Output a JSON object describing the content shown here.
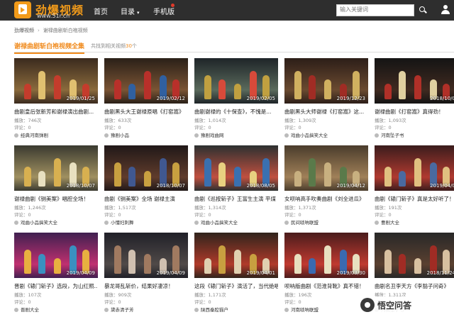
{
  "header": {
    "logo_text": "劲爆视频",
    "logo_domain": "www.51r.cn",
    "nav": [
      {
        "label": "首页"
      },
      {
        "label": "目录",
        "caret": "▾"
      },
      {
        "label": "手机版"
      }
    ],
    "search": {
      "placeholder": "输入关键词"
    },
    "brand_color": "#f29b1a"
  },
  "breadcrumb": {
    "items": [
      "劲爆视频",
      "谢禄曲剧斩白袍视频"
    ]
  },
  "section": {
    "title": "谢禄曲剧斩白袍视频全集",
    "count_prefix": "共找到相关视频",
    "count": "30",
    "count_suffix": "个",
    "accent_color": "#f08a1c"
  },
  "labels": {
    "play": "播放：",
    "comment": "评论："
  },
  "videos": [
    {
      "date": "2019/01/25",
      "title": "曲剧皇后张新芳和谢禄演出曲剧...",
      "plays": "746次",
      "comments": "0",
      "author": "经典河南弹剧"
    },
    {
      "date": "2019/02/12",
      "title": "曲剧黑头大王谢禄原唱《打窑嵩》",
      "plays": "633次",
      "comments": "0",
      "author": "豫剧小品"
    },
    {
      "date": "2019/02/05",
      "title": "曲剧谢禄的《十保查》，不愧是...",
      "plays": "1,014次",
      "comments": "0",
      "author": "豫剧戏曲网"
    },
    {
      "date": "2019/12/23",
      "title": "曲剧黑头大师谢禄《打窑嵩》这...",
      "plays": "1,309次",
      "comments": "0",
      "author": "戏曲小品搞笑大全"
    },
    {
      "date": "2018/10/0",
      "title": "谢禄曲剧《打窑嵩》真得劲！",
      "plays": "1,093次",
      "comments": "0",
      "author": "河南坠子书"
    },
    {
      "date": "2018/10/07",
      "title": "谢禄曲剧《铡美案》唱腔全场！",
      "plays": "1,246次",
      "comments": "0",
      "author": "戏曲小品搞笑大全"
    },
    {
      "date": "2018/10/07",
      "title": "曲剧《铡美案》全场 谢禄主演",
      "plays": "1,517次",
      "comments": "0",
      "author": "小懂妇刺舞"
    },
    {
      "date": "2018/08/05",
      "title": "曲剧《巡按斩子》王富生主演 平煤",
      "plays": "1,314次",
      "comments": "0",
      "author": "戏曲小品搞笑大全"
    },
    {
      "date": "2019/04/12",
      "title": "女呗呐高手吹奏曲剧《刘全进瓜》",
      "plays": "1,371次",
      "comments": "0",
      "author": "民间唢呐联盟"
    },
    {
      "date": "2019/04/0",
      "title": "曲剧《辕门斩子》真是太好听了！",
      "plays": "191次",
      "comments": "0",
      "author": "曹剧大全"
    },
    {
      "date": "2019/04/09",
      "title": "晋剧《辕门斩子》选段，为山红照...",
      "plays": "107次",
      "comments": "0",
      "author": "晋剧大全"
    },
    {
      "date": "2019/04/09",
      "title": "暴龙哥乱斩价，结果好凄凉！",
      "plays": "909次",
      "comments": "0",
      "author": "黛赤清子芳"
    },
    {
      "date": "2019/04/01",
      "title": "这段《辕门斩子》演活了，当代绝唱！",
      "plays": "1,171次",
      "comments": "0",
      "author": "陕西秦腔猫户"
    },
    {
      "date": "2019/03/30",
      "title": "呗呐版曲剧《范淮背靴》真不错！",
      "plays": "196次",
      "comments": "0",
      "author": "河南唢呐联盟"
    },
    {
      "date": "2018/11/24",
      "title": "曲剧名丑李天方《李豁子问奇》",
      "plays": "1,311次",
      "comments": "0",
      "author": "河南坠子书"
    }
  ],
  "watermark": {
    "text": "悟空问答"
  }
}
